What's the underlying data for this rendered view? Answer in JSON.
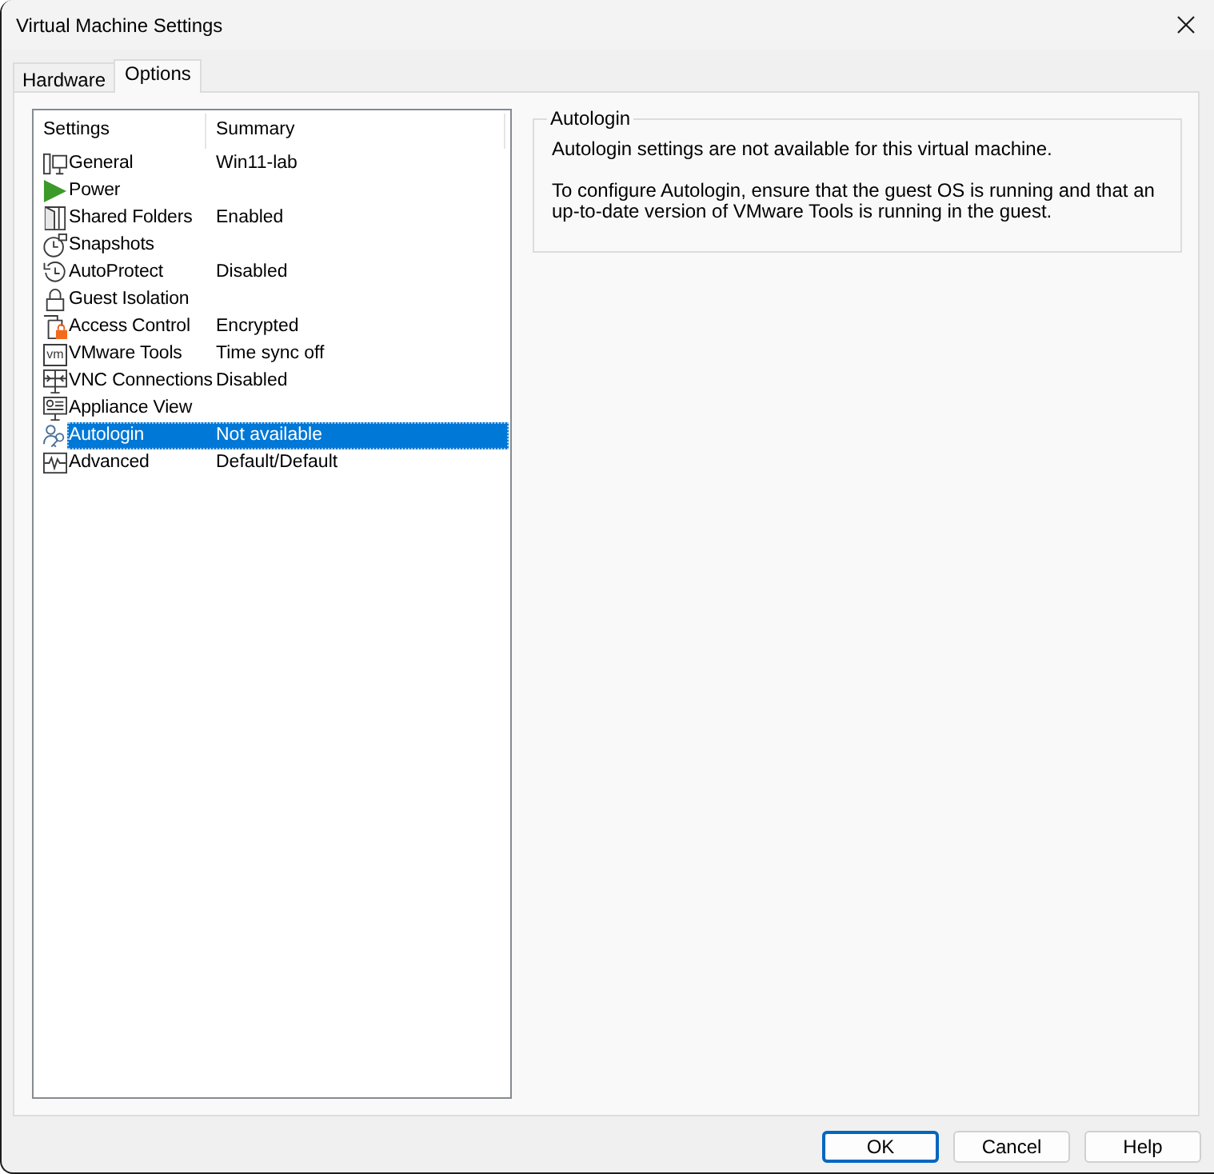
{
  "window": {
    "title": "Virtual Machine Settings"
  },
  "tabs": [
    {
      "label": "Hardware",
      "selected": false
    },
    {
      "label": "Options",
      "selected": true
    }
  ],
  "settings_list": {
    "columns": [
      "Settings",
      "Summary"
    ],
    "rows": [
      {
        "name": "General",
        "summary": "Win11-lab",
        "selected": false
      },
      {
        "name": "Power",
        "selected": false
      },
      {
        "name": "Shared Folders",
        "summary": "Enabled",
        "selected": false
      },
      {
        "name": "Snapshots",
        "selected": false
      },
      {
        "name": "AutoProtect",
        "summary": "Disabled",
        "selected": false
      },
      {
        "name": "Guest Isolation",
        "selected": false
      },
      {
        "name": "Access Control",
        "summary": "Encrypted",
        "selected": false
      },
      {
        "name": "VMware Tools",
        "summary": "Time sync off",
        "icon_text": "vm",
        "selected": false
      },
      {
        "name": "VNC Connections",
        "summary": "Disabled",
        "selected": false
      },
      {
        "name": "Appliance View",
        "selected": false
      },
      {
        "name": "Autologin",
        "summary": "Not available",
        "selected": true
      },
      {
        "name": "Advanced",
        "summary": "Default/Default",
        "selected": false
      }
    ]
  },
  "autologin_group": {
    "title": "Autologin",
    "paragraphs": [
      "Autologin settings are not available for this virtual machine.",
      "To configure Autologin, ensure that the guest OS is running and that an up-to-date version of VMware Tools is running in the guest."
    ]
  },
  "buttons": [
    {
      "label": "OK",
      "default": true
    },
    {
      "label": "Cancel",
      "default": false
    },
    {
      "label": "Help",
      "default": false
    }
  ]
}
